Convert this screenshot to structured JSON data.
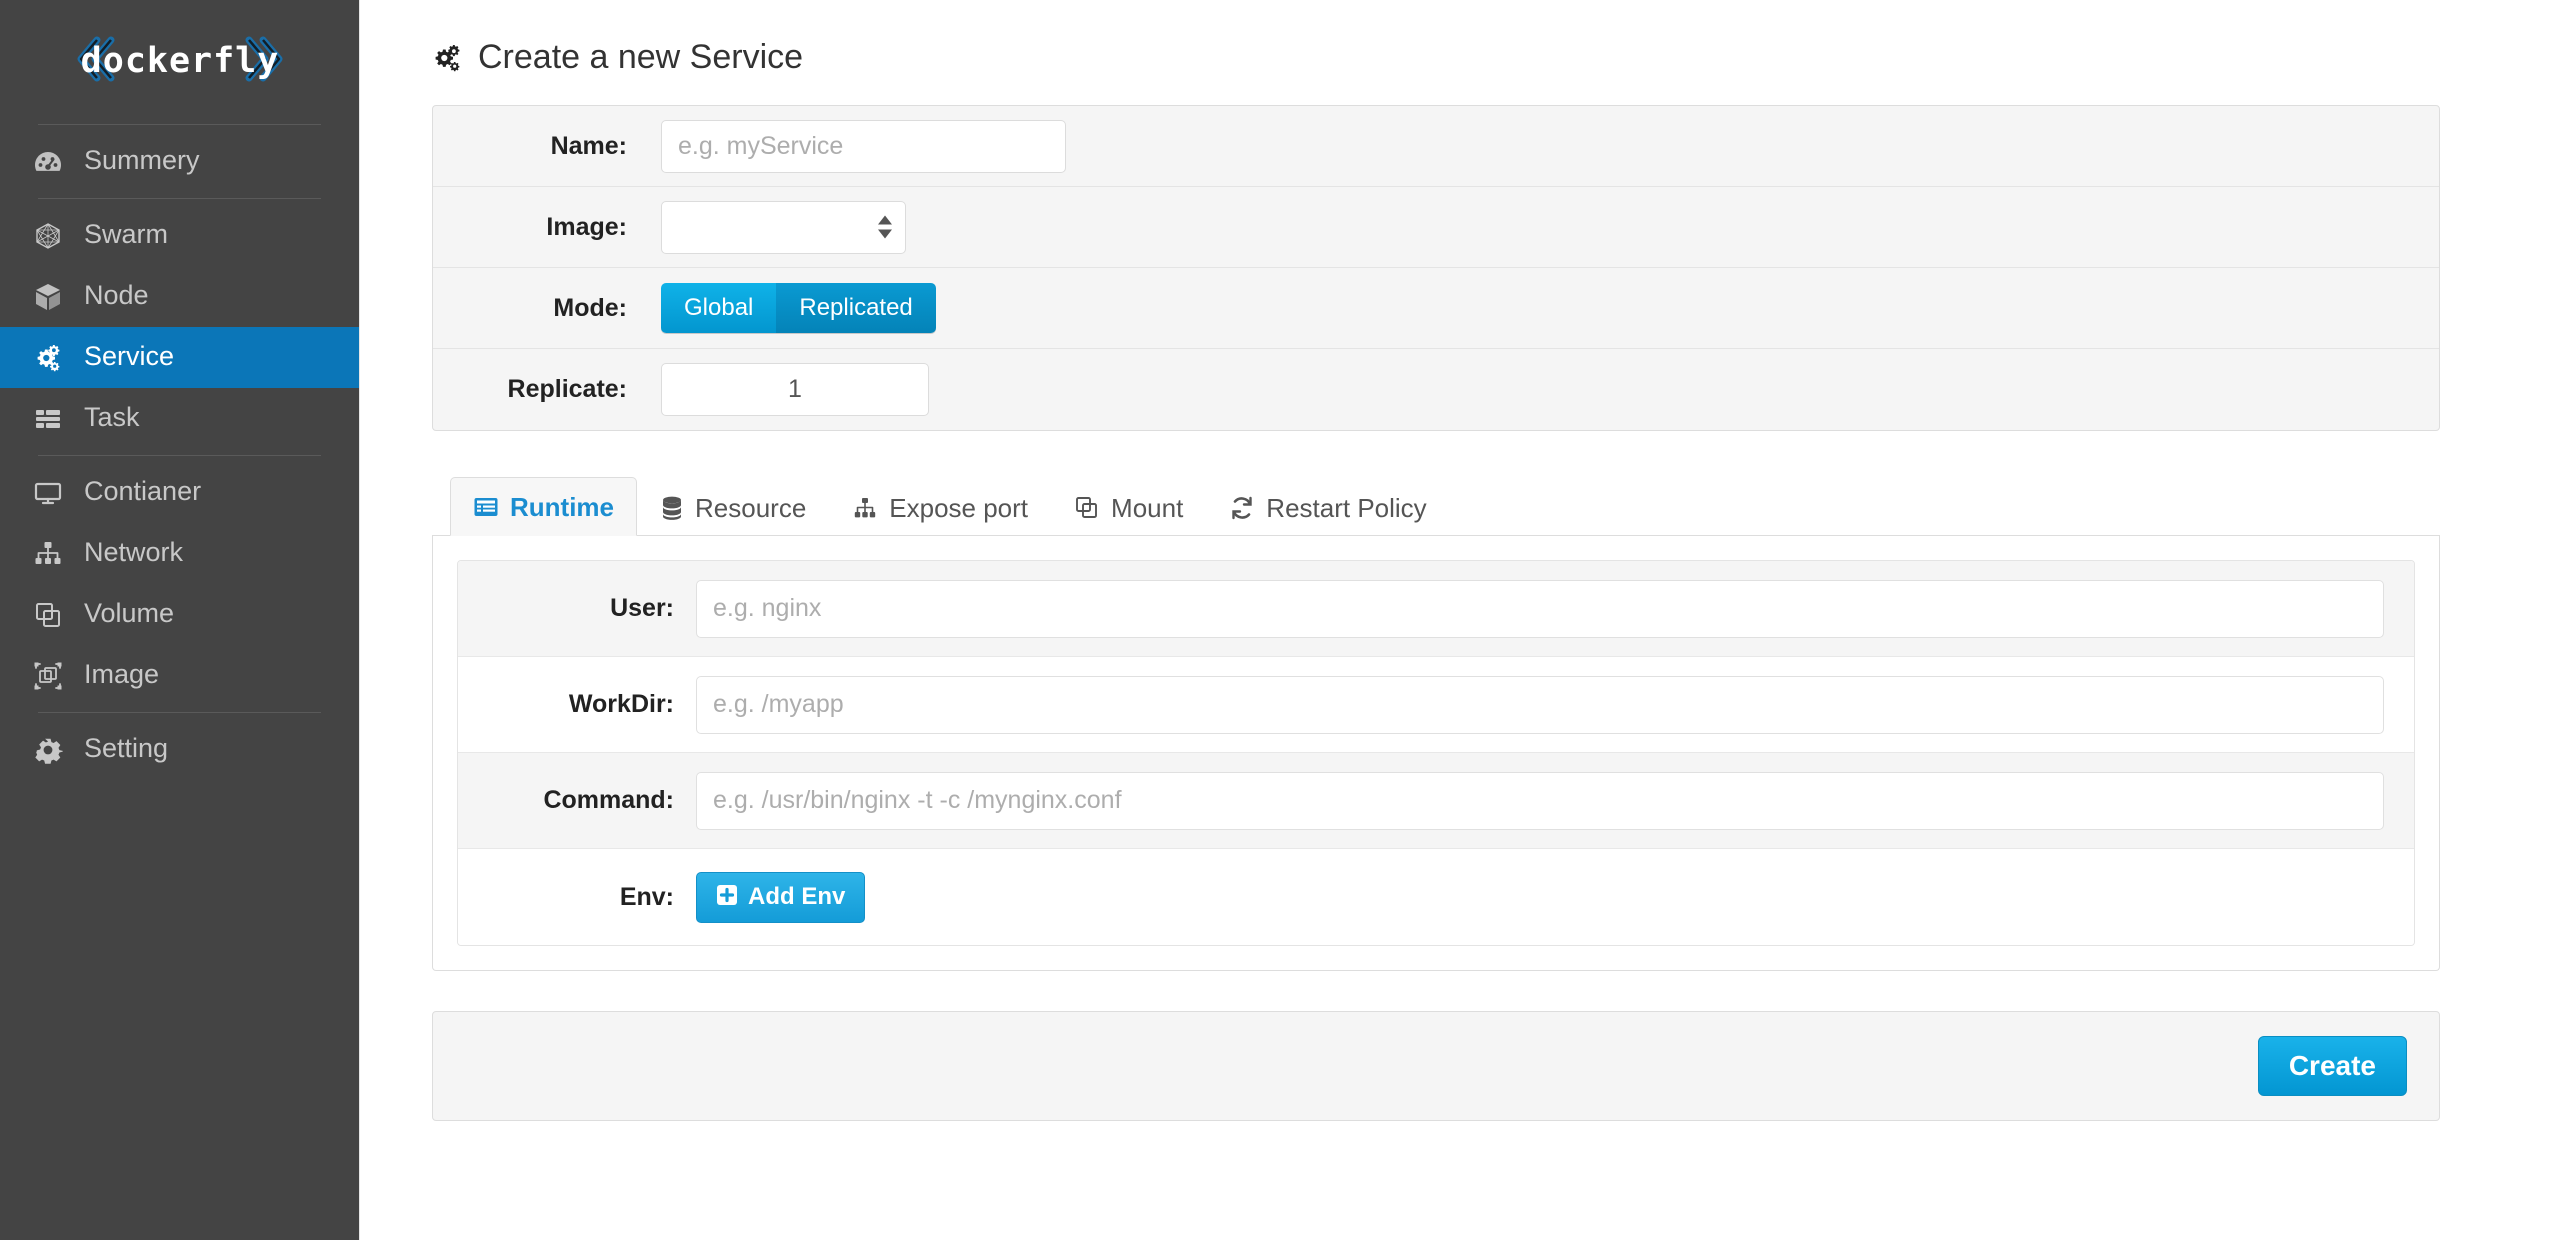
{
  "brand": {
    "name": "dockerfly"
  },
  "sidebar": {
    "items": [
      {
        "label": "Summery",
        "icon": "tachometer-icon",
        "active": false
      },
      {
        "label": "Swarm",
        "icon": "swarm-icon",
        "active": false
      },
      {
        "label": "Node",
        "icon": "cube-icon",
        "active": false
      },
      {
        "label": "Service",
        "icon": "cogs-icon",
        "active": true
      },
      {
        "label": "Task",
        "icon": "tasks-icon",
        "active": false
      },
      {
        "label": "Contianer",
        "icon": "desktop-icon",
        "active": false
      },
      {
        "label": "Network",
        "icon": "sitemap-icon",
        "active": false
      },
      {
        "label": "Volume",
        "icon": "clone-icon",
        "active": false
      },
      {
        "label": "Image",
        "icon": "image-icon",
        "active": false
      },
      {
        "label": "Setting",
        "icon": "gear-icon",
        "active": false
      }
    ]
  },
  "page": {
    "title": "Create a new Service",
    "title_icon": "cogs-icon"
  },
  "form": {
    "name": {
      "label": "Name:",
      "value": "",
      "placeholder": "e.g. myService"
    },
    "image": {
      "label": "Image:",
      "value": "",
      "placeholder": ""
    },
    "mode": {
      "label": "Mode:",
      "options": [
        "Global",
        "Replicated"
      ],
      "selected": "Global"
    },
    "replicate": {
      "label": "Replicate:",
      "value": "1",
      "placeholder": ""
    }
  },
  "tabs": [
    {
      "label": "Runtime",
      "icon": "list-alt-icon",
      "active": true
    },
    {
      "label": "Resource",
      "icon": "database-icon",
      "active": false
    },
    {
      "label": "Expose port",
      "icon": "sitemap-icon",
      "active": false
    },
    {
      "label": "Mount",
      "icon": "clone-icon",
      "active": false
    },
    {
      "label": "Restart Policy",
      "icon": "refresh-icon",
      "active": false
    }
  ],
  "runtime": {
    "user": {
      "label": "User:",
      "value": "",
      "placeholder": "e.g. nginx"
    },
    "workdir": {
      "label": "WorkDir:",
      "value": "",
      "placeholder": "e.g. /myapp"
    },
    "command": {
      "label": "Command:",
      "value": "",
      "placeholder": "e.g. /usr/bin/nginx -t -c /mynginx.conf"
    },
    "env": {
      "label": "Env:",
      "add_button": "Add Env",
      "add_icon": "plus-square-icon"
    }
  },
  "footer": {
    "create_button": "Create"
  },
  "colors": {
    "sidebar_bg": "#444444",
    "sidebar_active": "#0b76b8",
    "accent_blue": "#1b8dd0",
    "button_blue": "#149cd8",
    "panel_bg": "#f5f5f5",
    "border": "#dddddd"
  }
}
